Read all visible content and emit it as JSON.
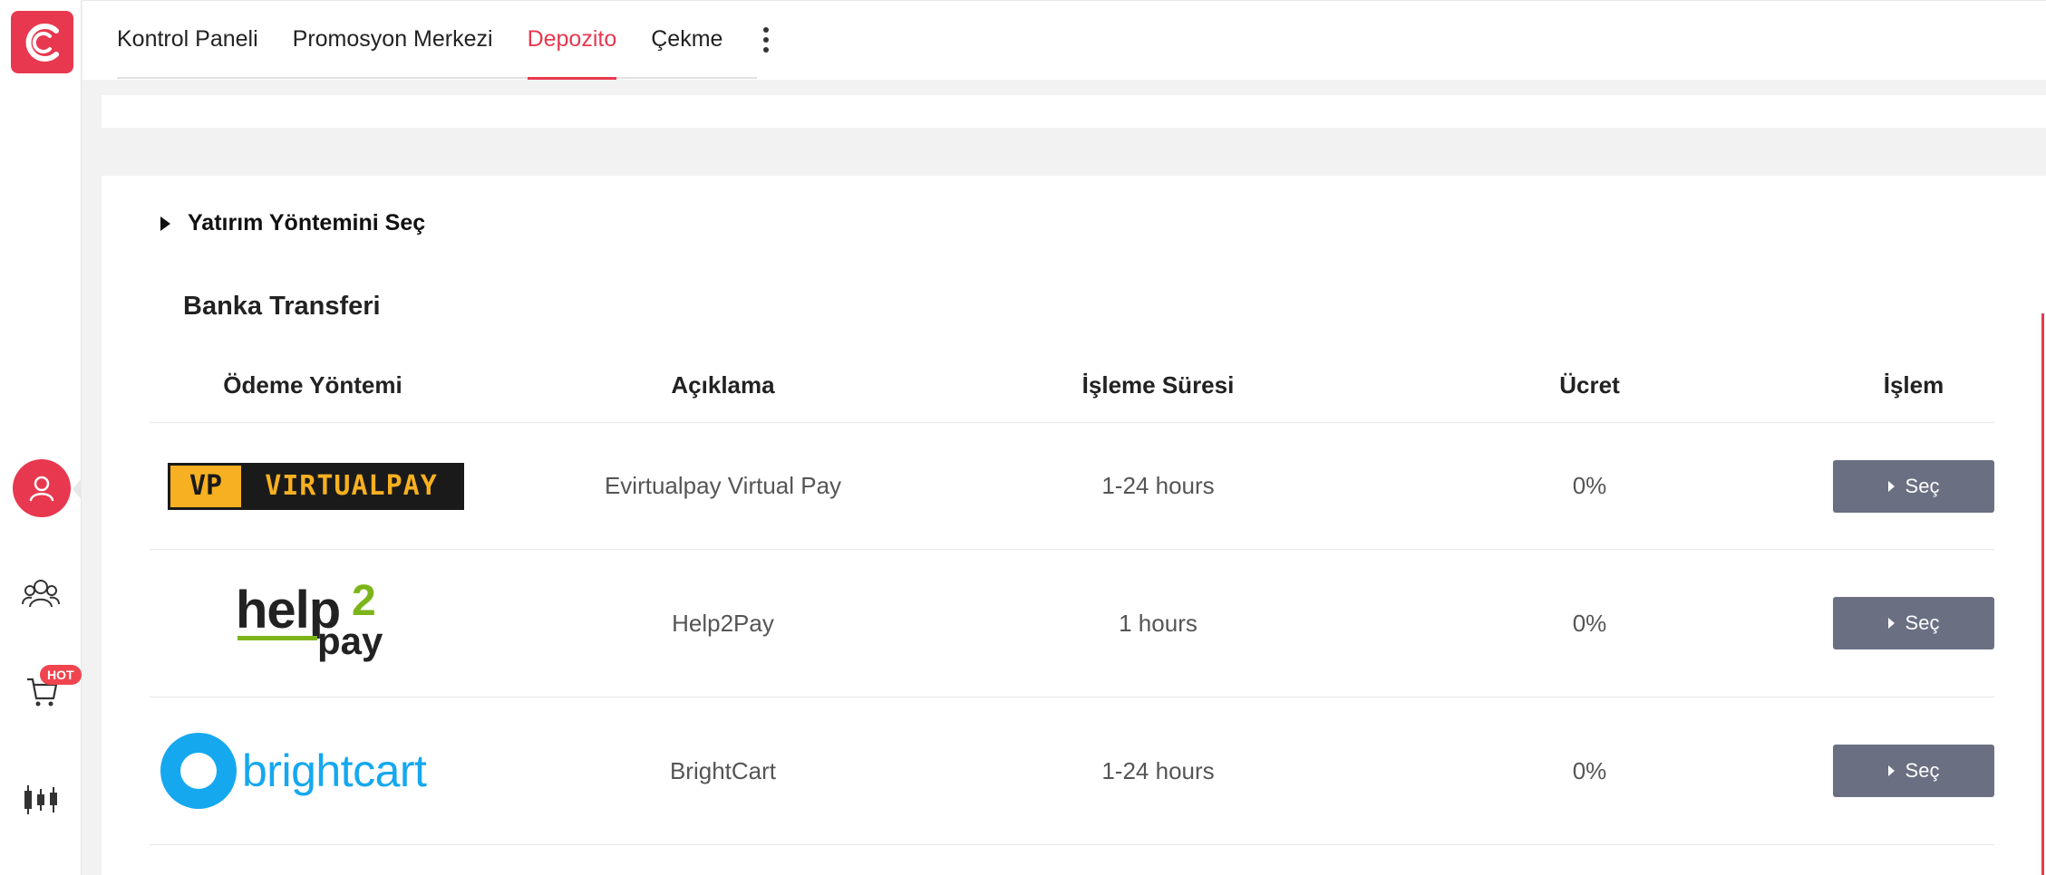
{
  "nav": {
    "tabs": [
      {
        "label": "Kontrol Paneli"
      },
      {
        "label": "Promosyon Merkezi"
      },
      {
        "label": "Depozito"
      },
      {
        "label": "Çekme"
      }
    ],
    "active_tab": "Depozito"
  },
  "sidebar": {
    "hot_badge": "HOT",
    "icons": [
      "brand-logo-icon",
      "user-icon",
      "group-icon",
      "cart-icon",
      "candlestick-chart-icon"
    ]
  },
  "deposit": {
    "section_title": "Yatırım Yöntemini Seç",
    "group_title": "Banka Transferi",
    "columns": [
      "Ödeme Yöntemi",
      "Açıklama",
      "İşleme Süresi",
      "Ücret",
      "İşlem"
    ],
    "rows": [
      {
        "logo": {
          "mark": "VP",
          "text": "VIRTUALPAY"
        },
        "description": "Evirtualpay Virtual Pay",
        "time": "1-24 hours",
        "fee": "0%",
        "action": "Seç"
      },
      {
        "logo": {
          "help": "help",
          "two": "2",
          "pay": "pay"
        },
        "description": "Help2Pay",
        "time": "1 hours",
        "fee": "0%",
        "action": "Seç"
      },
      {
        "logo": {
          "text": "brightcart"
        },
        "description": "BrightCart",
        "time": "1-24 hours",
        "fee": "0%",
        "action": "Seç"
      }
    ]
  },
  "colors": {
    "accent": "#e8384f",
    "button": "#6b6f82",
    "virtualpay_orange": "#f7b021",
    "help2pay_green": "#7cb519",
    "brightcart_blue": "#15a8ef"
  }
}
